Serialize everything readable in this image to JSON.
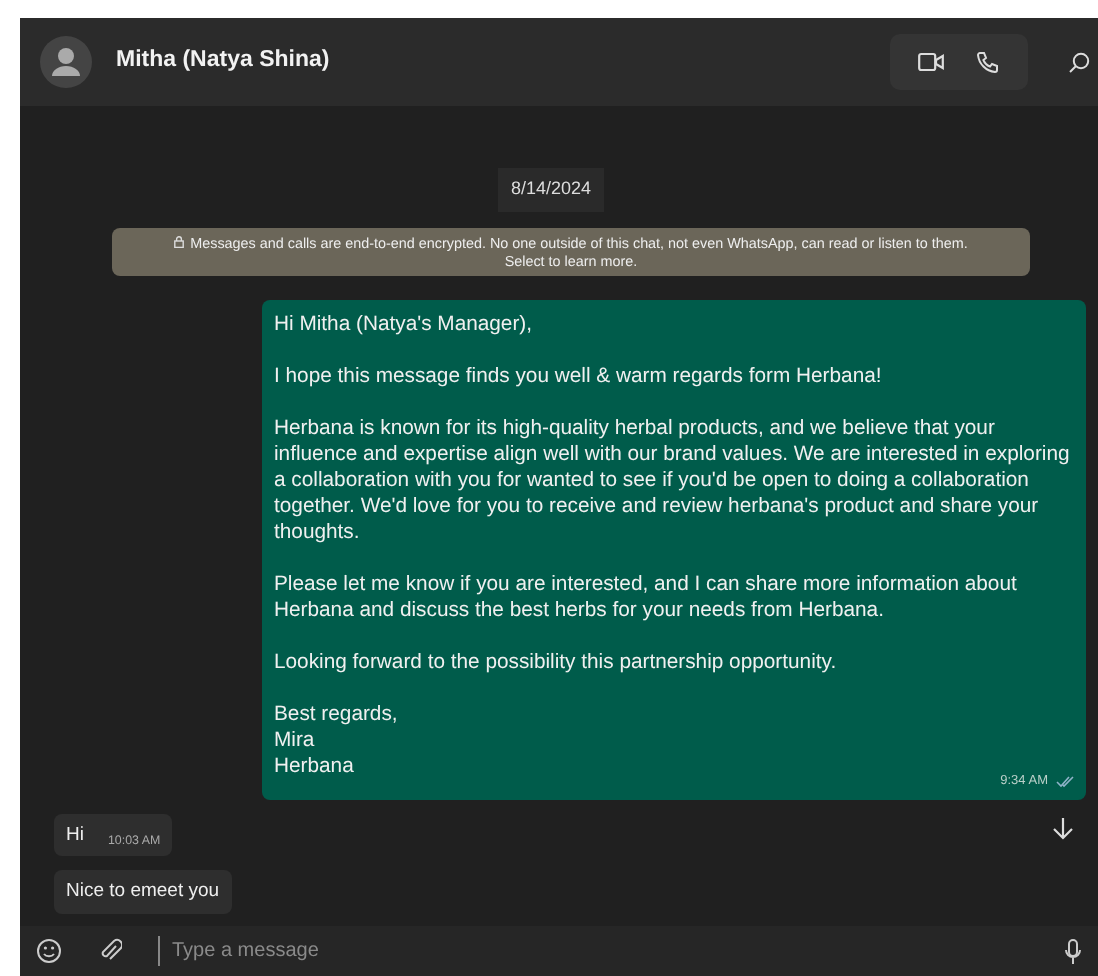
{
  "header": {
    "contact_name": "Mitha (Natya Shina)"
  },
  "date_badge": "8/14/2024",
  "encryption_notice": {
    "lines": [
      "Messages and calls are end-to-end encrypted. No one outside of this chat, not even WhatsApp, can read or listen to them.",
      "Select to learn more."
    ]
  },
  "messages": [
    {
      "kind": "outgoing",
      "paragraphs": [
        [
          "Hi Mitha (Natya's Manager),"
        ],
        [
          "I hope this message finds you well & warm regards form Herbana!"
        ],
        [
          "Herbana is known for its high-quality herbal products, and we believe that your influence and expertise align well with our brand values. We are interested in exploring a collaboration with you for wanted to see if you'd be open to doing a collaboration together. We'd love for you to receive and review herbana's product and share your thoughts."
        ],
        [
          "Please let me know if you are interested, and I can share more information about Herbana and discuss the best herbs for your needs from Herbana."
        ],
        [
          "Looking forward to the possibility this partnership opportunity."
        ],
        [
          "Best regards,",
          "Mira",
          "Herbana"
        ]
      ],
      "time": "9:34 AM",
      "read": true
    },
    {
      "kind": "incoming",
      "paragraphs": [
        [
          "Hi"
        ]
      ],
      "time": "10:03 AM"
    },
    {
      "kind": "incoming",
      "paragraphs": [
        [
          "Nice to emeet you"
        ]
      ]
    }
  ],
  "composer": {
    "placeholder": "Type a message"
  }
}
